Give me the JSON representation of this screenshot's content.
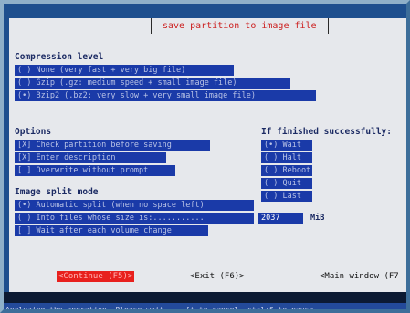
{
  "dialog": {
    "title": "save partition to image file"
  },
  "compression": {
    "heading": "Compression level",
    "options": [
      "( ) None (very fast + very big file)",
      "( ) Gzip (.gz: medium speed + small image file)",
      "(•) Bzip2 (.bz2: very slow + very small image file)"
    ]
  },
  "options": {
    "heading": "Options",
    "items": [
      "[X] Check partition before saving",
      "[X] Enter description",
      "[ ] Overwrite without prompt"
    ]
  },
  "finished": {
    "heading": "If finished successfully:",
    "items": [
      "(•) Wait",
      "( ) Halt",
      "( ) Reboot",
      "( ) Quit",
      "( ) Last"
    ]
  },
  "split": {
    "heading": "Image split mode",
    "options": [
      "(•) Automatic split (when no space left)",
      "( ) Into files whose size is:..........."
    ],
    "size_value": "2037",
    "size_unit": "MiB",
    "wait_option": "[ ] Wait after each volume change"
  },
  "buttons": {
    "continue": "<Continue (F5)>",
    "exit": "<Exit (F6)>",
    "main_window": "<Main window (F7"
  },
  "status_text": "Analyzing the operation. Please wait ... [t to cancel, ctrl+S to pause"
}
